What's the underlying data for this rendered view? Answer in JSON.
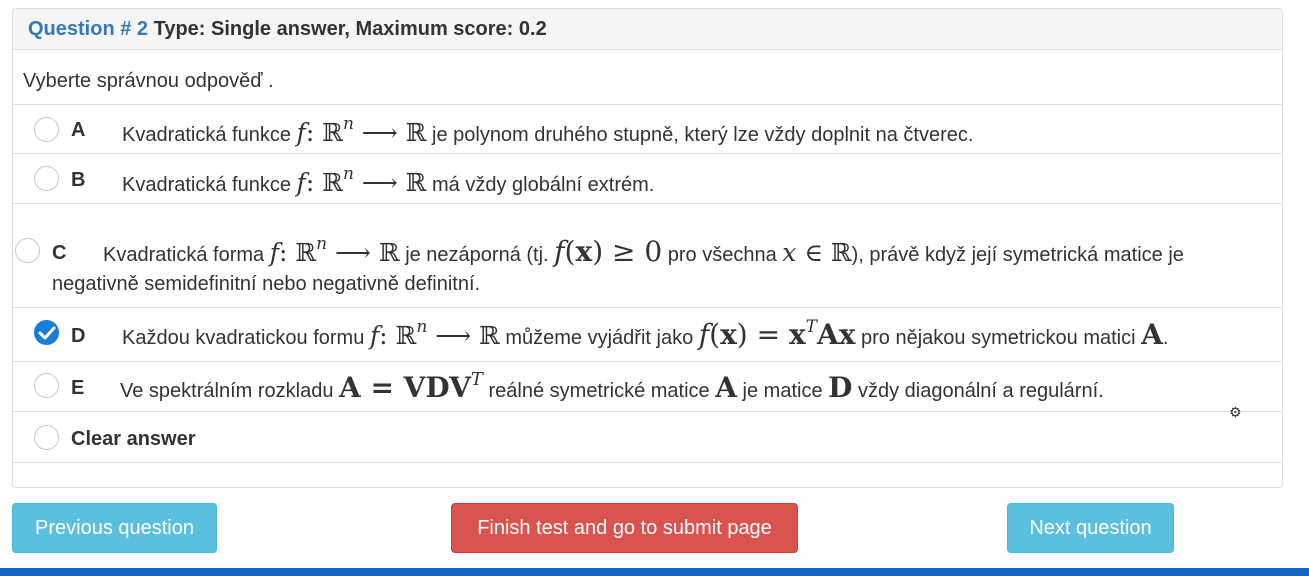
{
  "question": {
    "number_label": "Question # 2",
    "type_label": "Type: Single answer, Maximum score: 0.2",
    "instruction": "Vyberte správnou odpověď ."
  },
  "options": {
    "a": {
      "letter": "A",
      "t1": "Kvadratická funkce",
      "t2": "je polynom druhého stupně, který lze vždy doplnit na čtverec.",
      "checked": false
    },
    "b": {
      "letter": "B",
      "t1": "Kvadratická funkce",
      "t2": "má vždy globální extrém.",
      "checked": false
    },
    "c": {
      "letter": "C",
      "t1": "Kvadratická forma",
      "t2": "je nezáporná (tj.",
      "t3": "pro všechna",
      "t4": "), právě když její symetrická matice je",
      "t5": "negativně semidefinitní nebo negativně definitní.",
      "checked": false
    },
    "d": {
      "letter": "D",
      "t1": "Každou kvadratickou formu",
      "t2": "můžeme vyjádřit jako",
      "t3": "pro nějakou symetrickou matici",
      "checked": true
    },
    "e": {
      "letter": "E",
      "t1": "Ve spektrálním rozkladu",
      "t2": "reálné symetrické matice",
      "t3": "je matice",
      "t4": "vždy diagonální a regulární.",
      "checked": false
    },
    "clear_label": "Clear answer"
  },
  "buttons": {
    "previous": "Previous question",
    "finish": "Finish test and go to submit page",
    "next": "Next question"
  },
  "colors": {
    "accent_blue": "#337ab7",
    "checked_blue": "#1a7cd6",
    "info_button": "#5bc0de",
    "danger_button": "#d9534f",
    "bottom_bar": "#1265c0"
  }
}
